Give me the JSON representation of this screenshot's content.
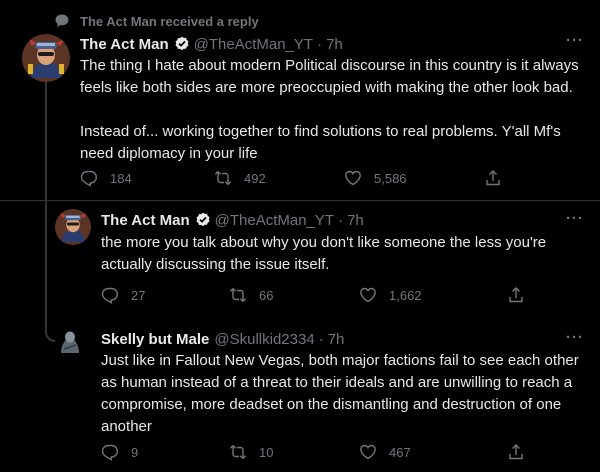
{
  "context": {
    "text": "The Act Man received a reply",
    "icon": "speech-bubble-icon"
  },
  "colors": {
    "background": "#000000",
    "text": "#e7e9ea",
    "muted": "#71767b",
    "badge": "#e7e9ea",
    "line": "#333639"
  },
  "tweets": [
    {
      "name": "The Act Man",
      "handle": "@TheActMan_YT",
      "sep": "·",
      "time": "7h",
      "more": "···",
      "verified": true,
      "text": "The thing I hate about modern Political discourse in this country is it always feels like both sides are more preoccupied with making the other look bad.\n\nInstead of... working together to find solutions to real problems. Y'all Mf's need diplomacy in your life",
      "replies": "184",
      "retweets": "492",
      "likes": "5,586"
    },
    {
      "name": "The Act Man",
      "handle": "@TheActMan_YT",
      "sep": "·",
      "time": "7h",
      "more": "···",
      "verified": true,
      "text": "the more you talk about why you don't like someone the less you're actually discussing the issue itself.",
      "replies": "27",
      "retweets": "66",
      "likes": "1,662"
    },
    {
      "name": "Skelly but Male",
      "handle": "@Skullkid2334",
      "sep": "·",
      "time": "7h",
      "more": "···",
      "verified": false,
      "text": "Just like in Fallout New Vegas, both major factions fail to see each other as human instead of a threat to their ideals and are unwilling to reach a compromise, more deadset on the dismantling and destruction of one another",
      "replies": "9",
      "retweets": "10",
      "likes": "467"
    }
  ]
}
